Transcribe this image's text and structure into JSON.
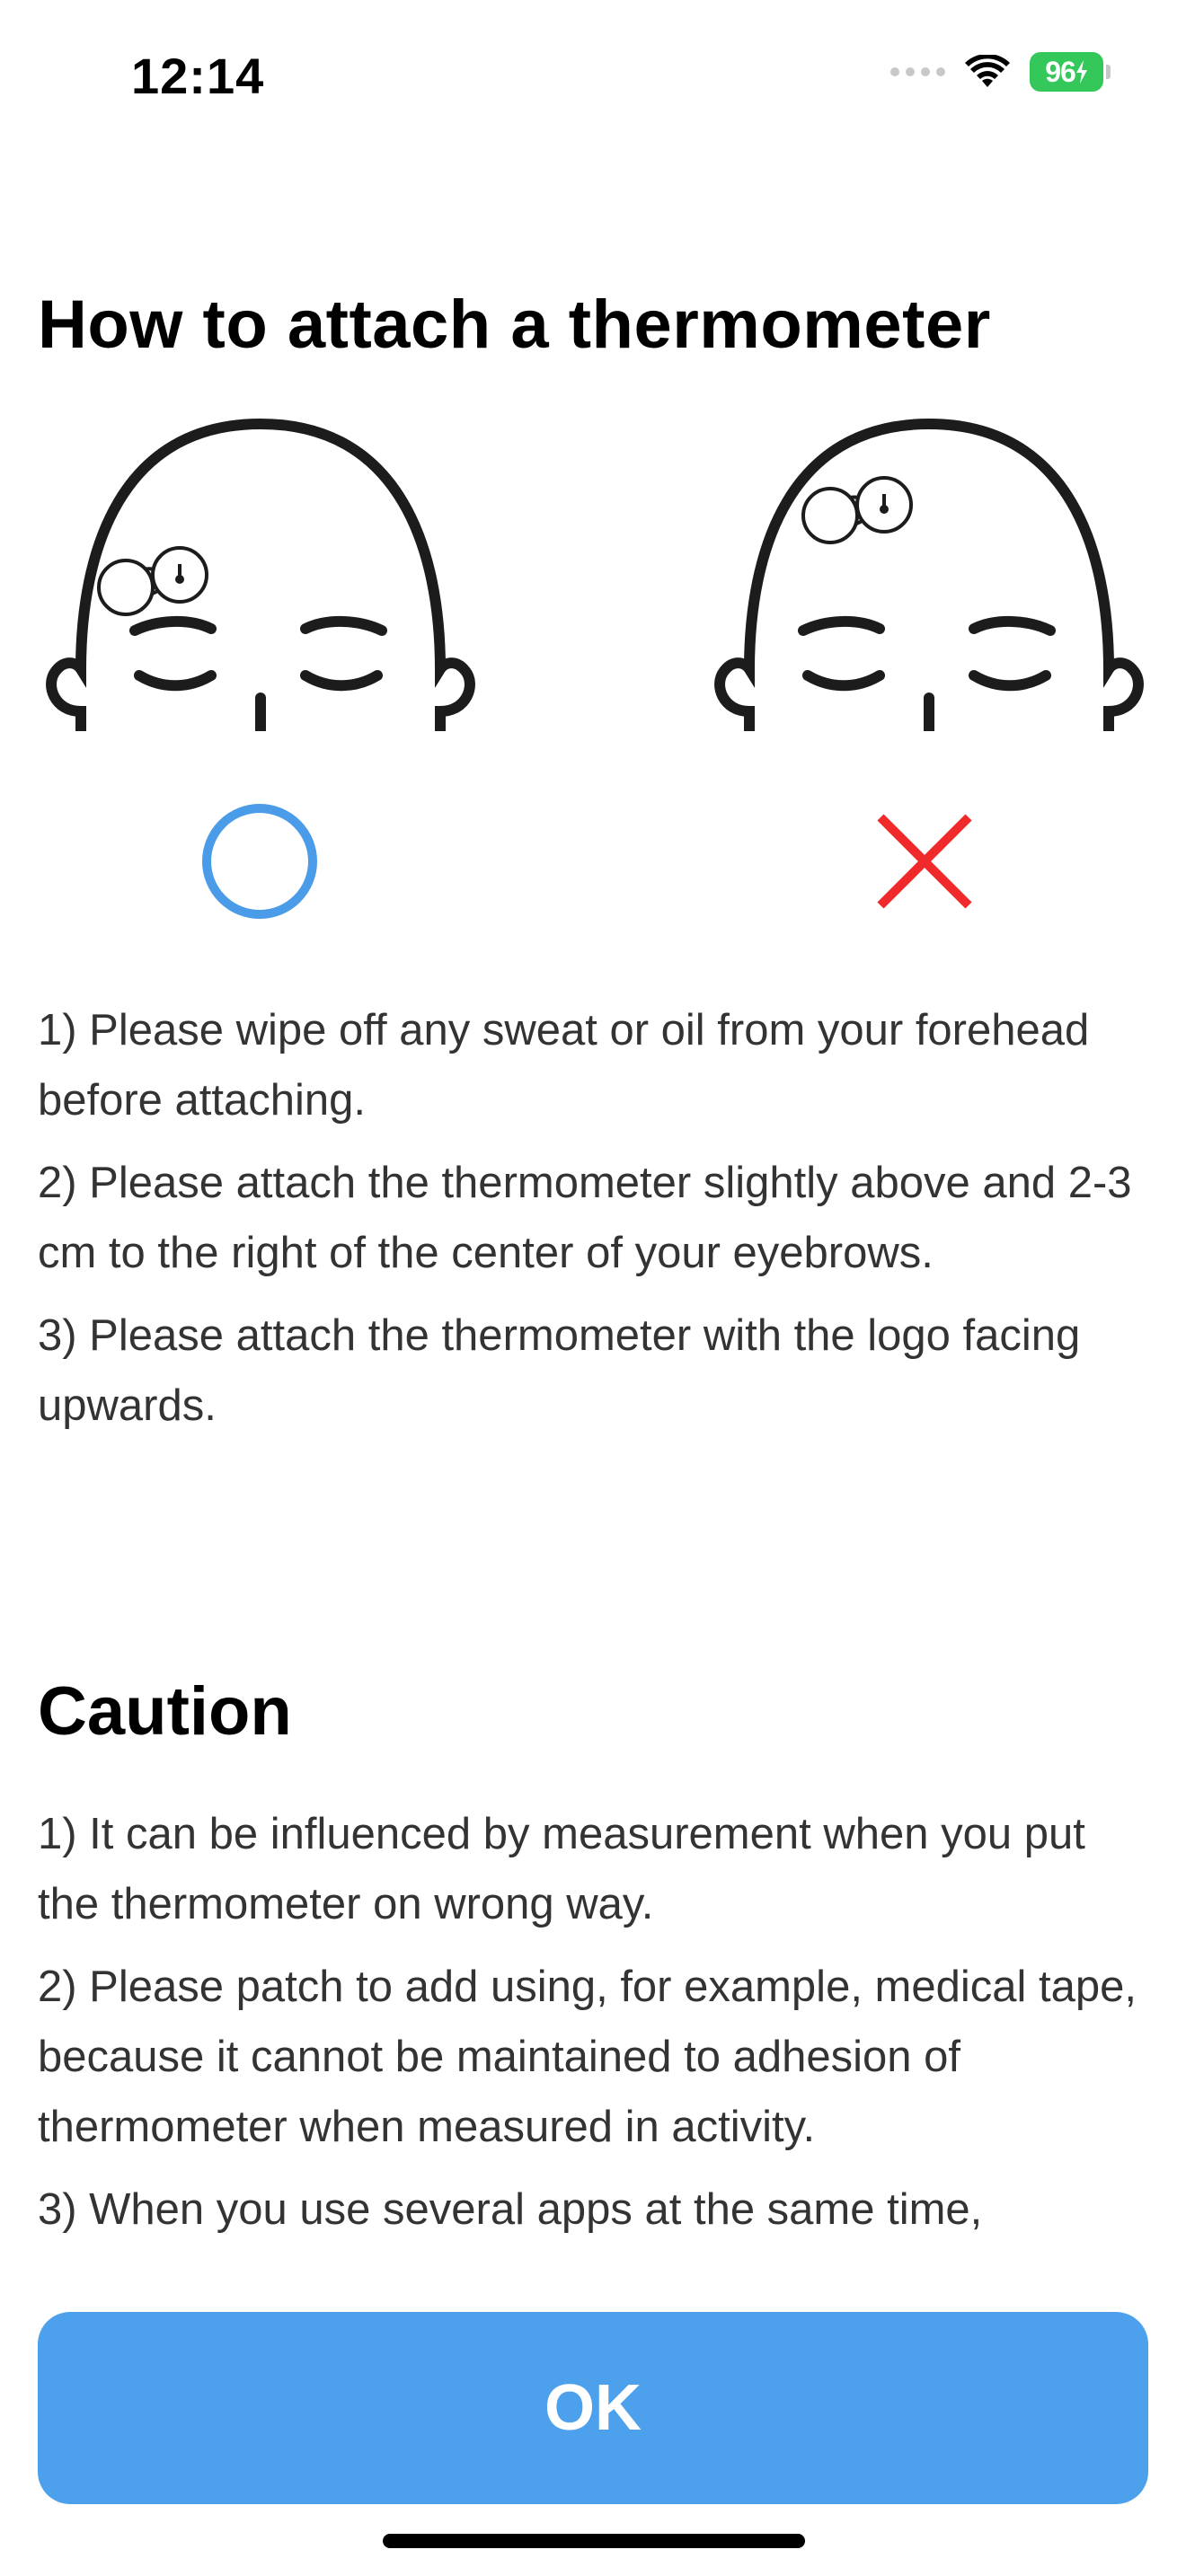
{
  "status_bar": {
    "time": "12:14",
    "battery_level": "96",
    "battery_color": "#34c759",
    "icons": [
      "signal-dots-icon",
      "wifi-icon",
      "battery-charging-icon"
    ]
  },
  "attach_section": {
    "title": "How to attach a thermometer",
    "correct_mark_icon": "circle-ok-icon",
    "wrong_mark_icon": "cross-ng-icon",
    "correct_color": "#4a9be8",
    "wrong_color": "#f02a2a",
    "instructions": [
      "1) Please wipe off any sweat or oil from your forehead before attaching.",
      "2) Please attach the thermometer slightly above and 2-3 cm to the right of the center of your eyebrows.",
      "3) Please attach the thermometer with the logo facing upwards."
    ]
  },
  "caution_section": {
    "title": "Caution",
    "items": [
      "1) It can be influenced by measurement when you put the thermometer on wrong way.",
      "2) Please patch to add using, for example, medical tape, because it cannot be maintained to adhesion of thermometer when measured in activity.",
      "3) When you use several apps at the same time,"
    ]
  },
  "footer": {
    "ok_label": "OK",
    "button_color": "#4da1ec"
  }
}
